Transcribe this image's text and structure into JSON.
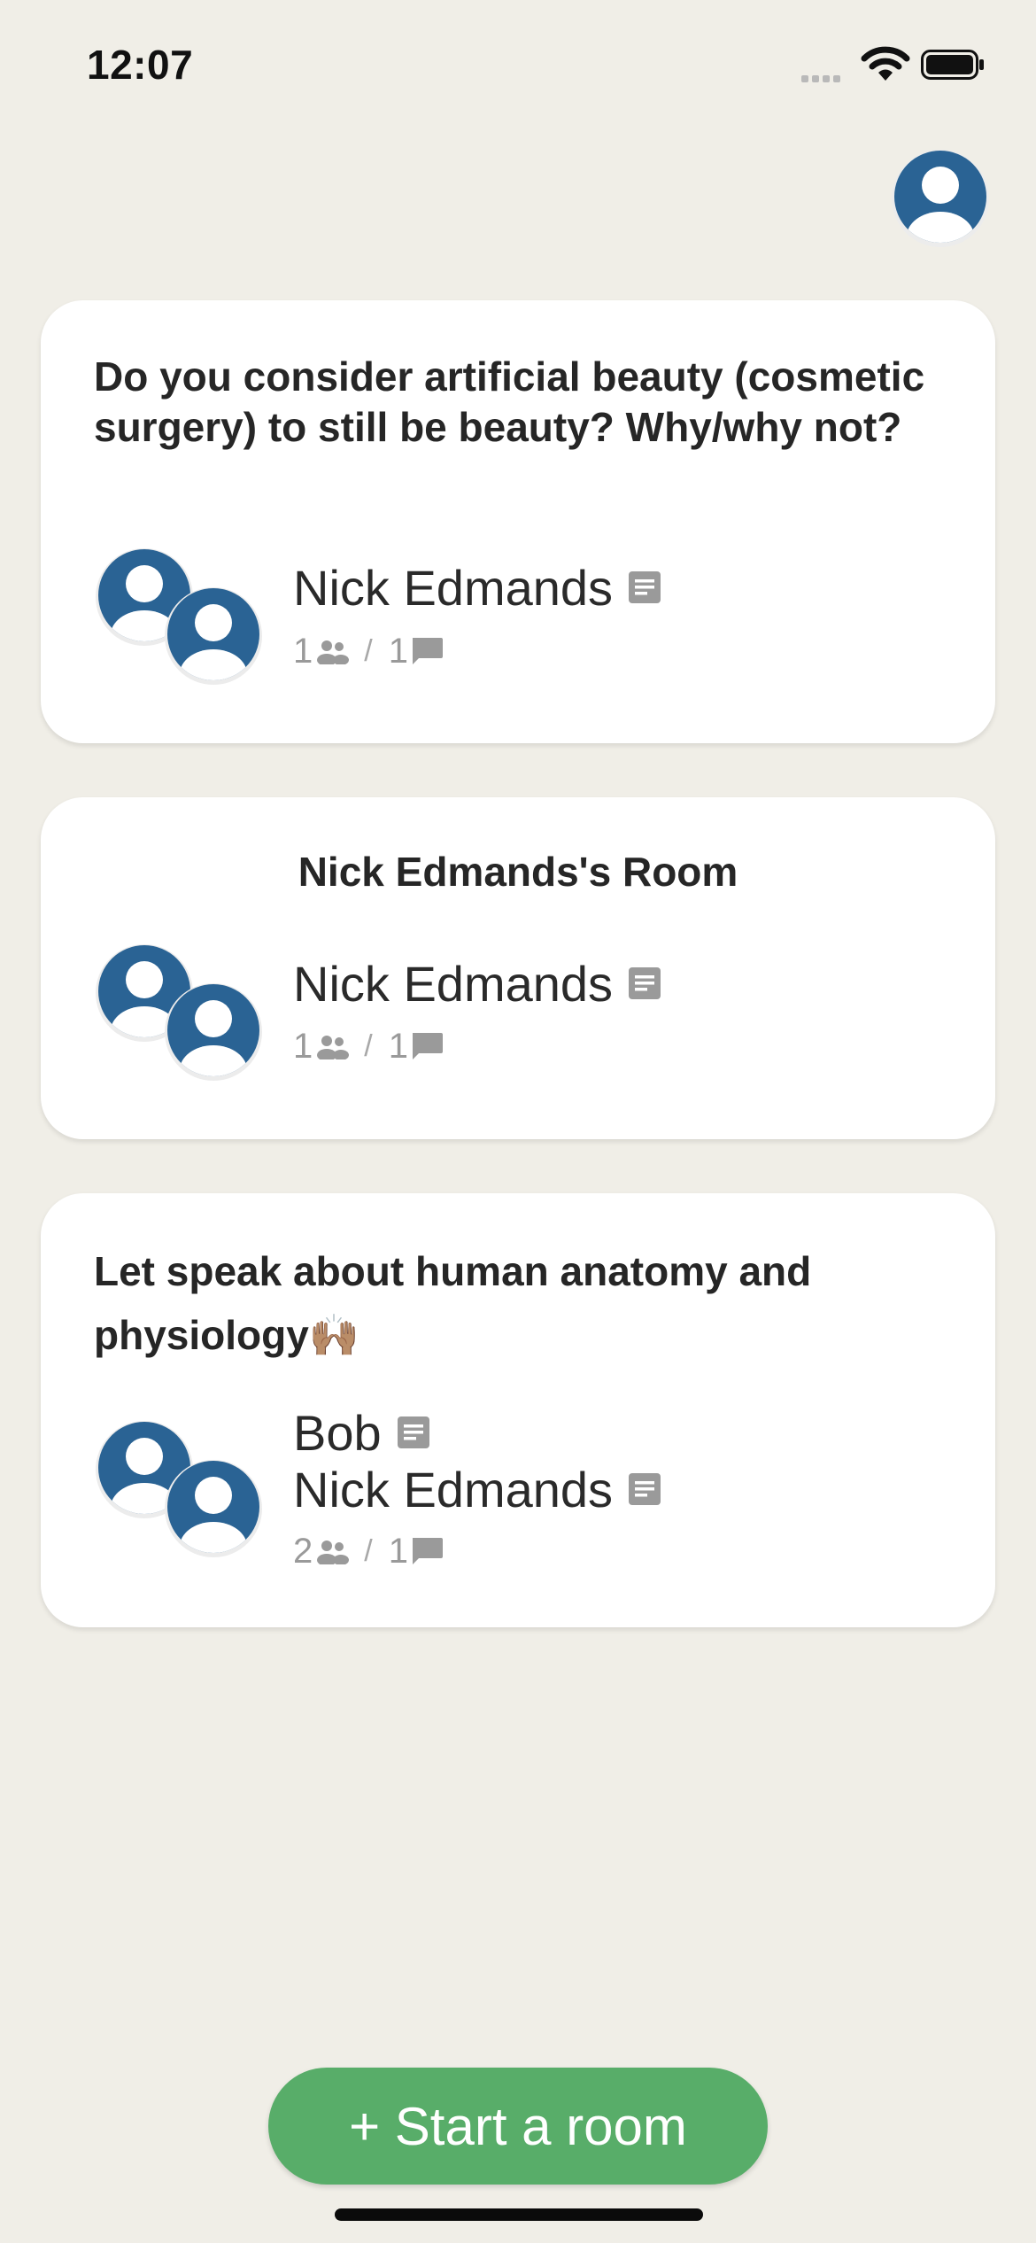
{
  "status_bar": {
    "time": "12:07"
  },
  "rooms": [
    {
      "title": "Do you consider artificial beauty (cosmetic surgery) to still be beauty? Why/why not?",
      "members": [
        "Nick Edmands"
      ],
      "participants": "1",
      "messages": "1"
    },
    {
      "title": "Nick Edmands's Room",
      "members": [
        "Nick Edmands"
      ],
      "participants": "1",
      "messages": "1"
    },
    {
      "title": "Let speak about human anatomy and physiology🙌🏽",
      "members": [
        "Bob",
        "Nick Edmands"
      ],
      "participants": "2",
      "messages": "1"
    }
  ],
  "separator": "/",
  "start_room_label": "+ Start a room",
  "colors": {
    "background": "#f0eee7",
    "avatar": "#2a6394",
    "accent_button": "#58ad69",
    "muted_icon": "#9a9a9a"
  },
  "icons": [
    "signal-icon",
    "wifi-icon",
    "battery-icon",
    "avatar-icon",
    "message-icon",
    "participants-icon",
    "chat-bubble-icon"
  ]
}
